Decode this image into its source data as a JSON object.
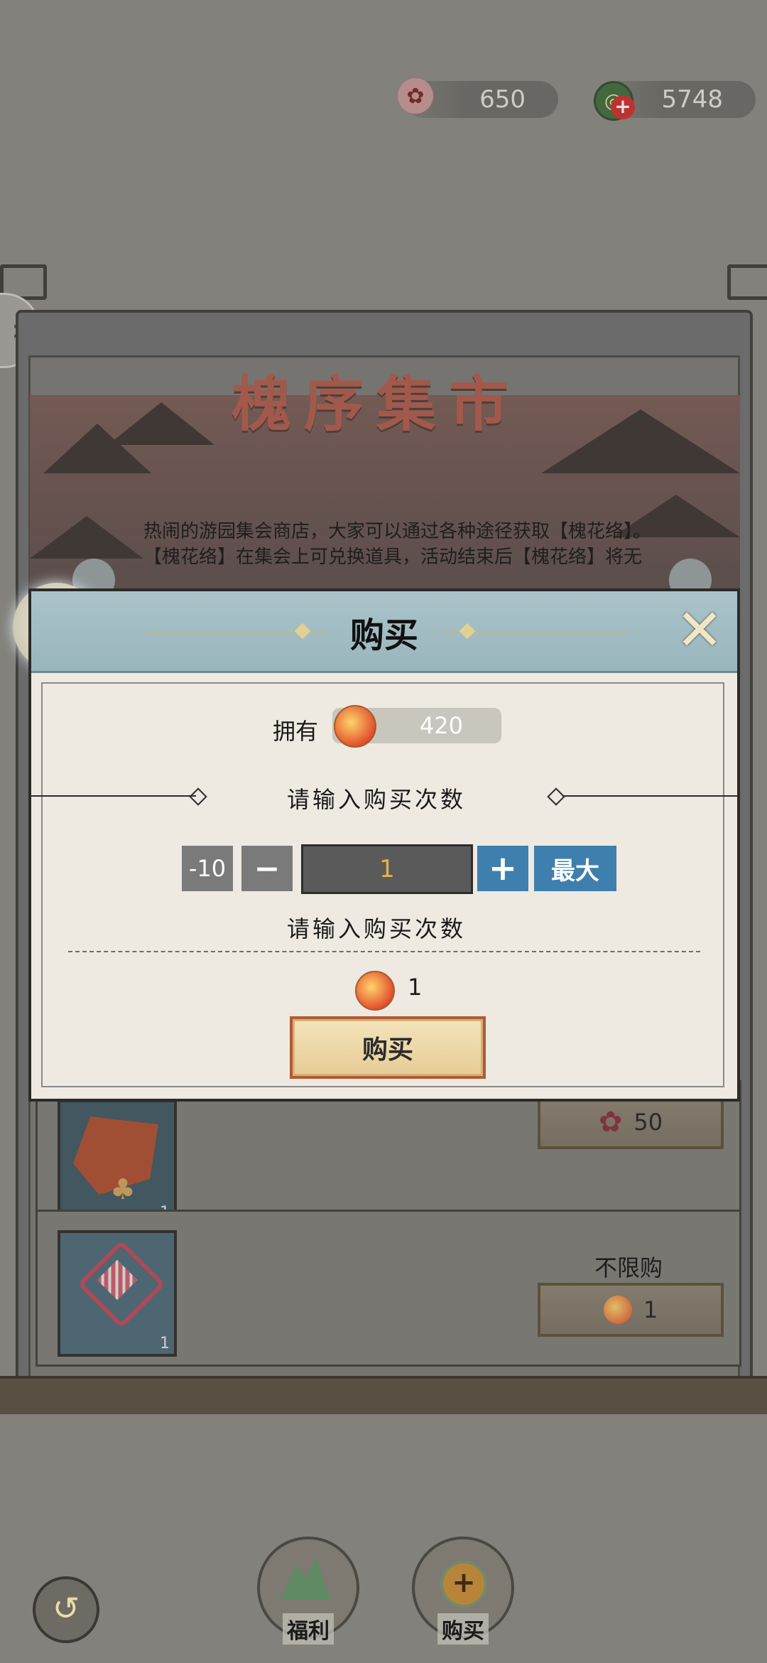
{
  "currencies": [
    {
      "icon": "knot-flower-icon",
      "value": "650"
    },
    {
      "icon": "jade-coin-icon",
      "value": "5748"
    }
  ],
  "shop": {
    "title": "槐序集市",
    "description": "热闹的游园集会商店，大家可以通过各种途径获取【槐花络】。【槐花络】在集会上可兑换道具，活动结束后【槐花络】将无"
  },
  "items": [
    {
      "icon": "lantern-icon",
      "count": "1",
      "limit": "",
      "price": "50",
      "price_icon": "knot-flower-icon"
    },
    {
      "icon": "chinese-knot-icon",
      "count": "1",
      "limit": "不限购",
      "price": "1",
      "price_icon": "orb-token-icon"
    }
  ],
  "dialog": {
    "title": "购买",
    "owned_label": "拥有",
    "owned_value": "420",
    "prompt_top": "请输入购买次数",
    "minus10_label": "-10",
    "minus_label": "−",
    "quantity": "1",
    "plus_label": "+",
    "max_label": "最大",
    "prompt_bottom": "请输入购买次数",
    "cost": "1",
    "buy_label": "购买"
  },
  "bottom_nav": {
    "welfare_label": "福利",
    "buy_label": "购买"
  },
  "colors": {
    "accent_blue": "#3f7fae",
    "stepper_grey": "#7a7a7a",
    "buy_border": "#b15a36"
  }
}
